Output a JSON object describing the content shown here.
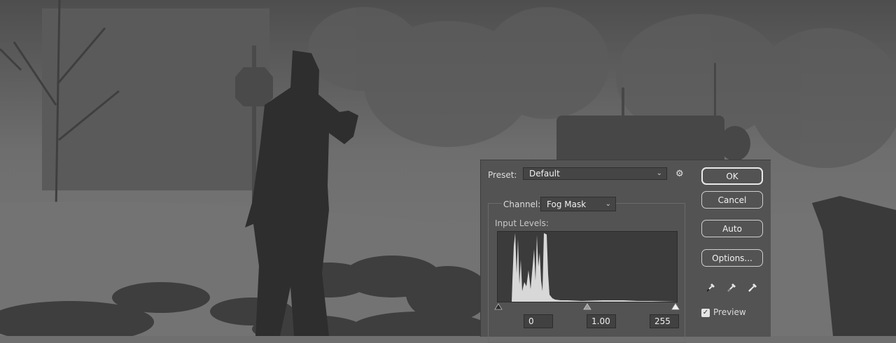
{
  "dialog": {
    "preset_label": "Preset:",
    "preset_value": "Default",
    "channel_label": "Channel:",
    "channel_value": "Fog Mask",
    "input_levels_label": "Input Levels:",
    "input_black": "0",
    "input_gamma": "1.00",
    "input_white": "255",
    "buttons": {
      "ok": "OK",
      "cancel": "Cancel",
      "auto": "Auto",
      "options": "Options..."
    },
    "preview_label": "Preview",
    "preview_checked": true,
    "icons": [
      "gear-icon",
      "black-eyedropper-icon",
      "gray-eyedropper-icon",
      "white-eyedropper-icon"
    ]
  },
  "colors": {
    "dialog_bg": "#535353",
    "histogram_bg": "#3b3b3b",
    "histogram_fill": "#d8d8d8"
  }
}
